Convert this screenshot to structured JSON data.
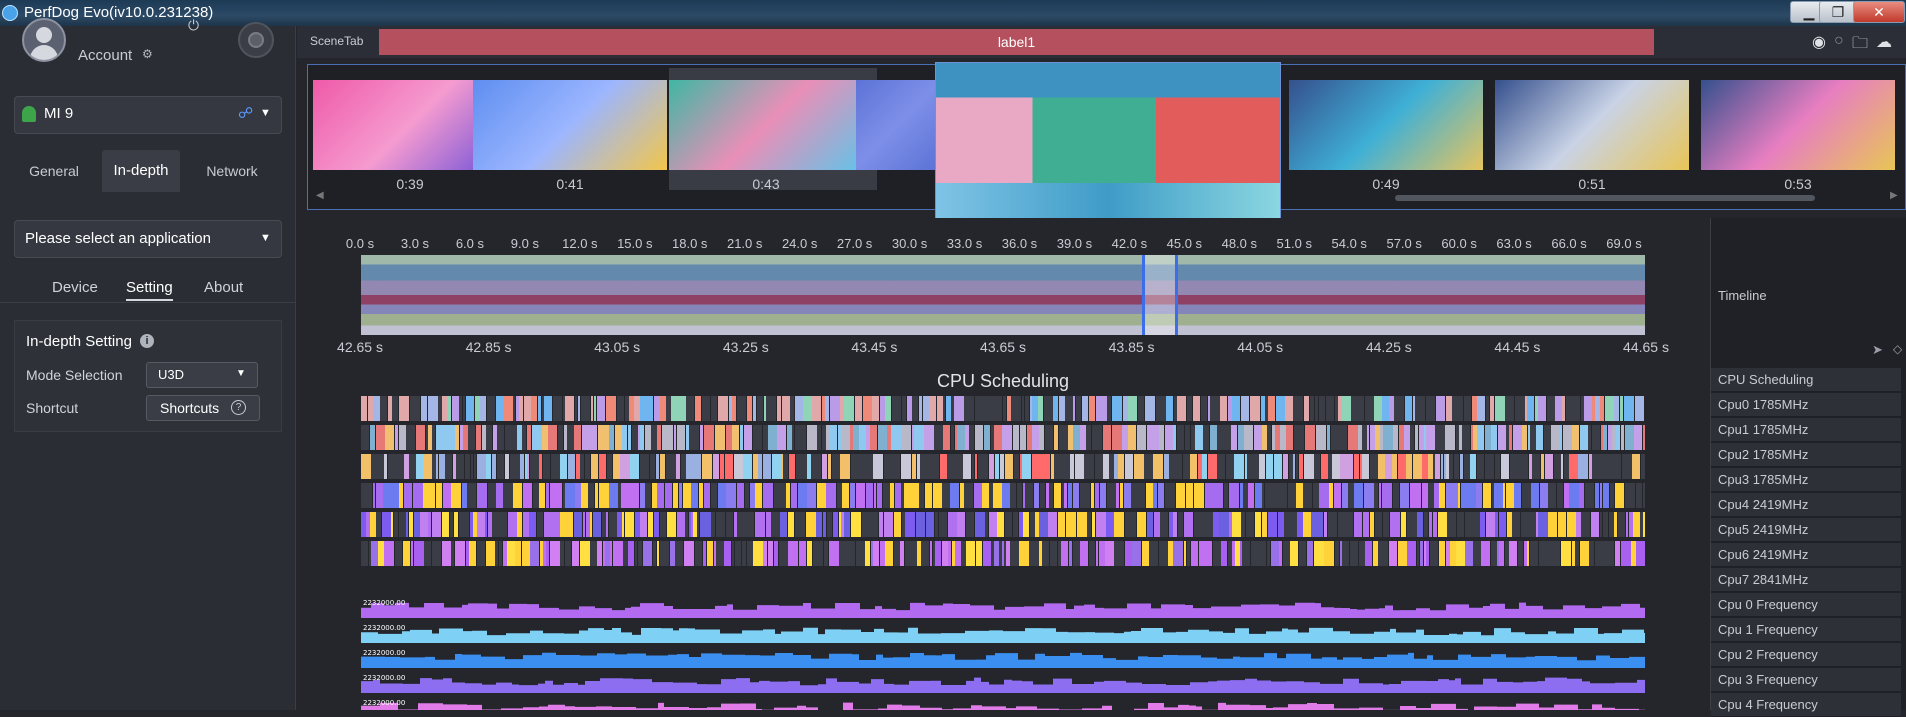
{
  "window": {
    "title": "PerfDog Evo(iv10.0.231238)",
    "minimize": "▁",
    "maximize": "❐",
    "close": "✕"
  },
  "left": {
    "account_label": "Account",
    "device": "MI 9",
    "tabs": [
      "General",
      "In-depth",
      "Network"
    ],
    "app_select_placeholder": "Please select an application",
    "subtabs": [
      "Device",
      "Setting",
      "About"
    ],
    "settings": {
      "title": "In-depth Setting",
      "mode_label": "Mode Selection",
      "mode_value": "U3D",
      "shortcut_label": "Shortcut",
      "shortcut_button": "Shortcuts"
    }
  },
  "scene": {
    "tab_label": "SceneTab",
    "label": "label1"
  },
  "thumbnails": [
    {
      "time": "0:39",
      "colors": [
        "#ef5aa8",
        "#f59bd0",
        "#6b4fd8"
      ]
    },
    {
      "time": "0:41",
      "colors": [
        "#5e8ef0",
        "#9cb6ff",
        "#f2c64b"
      ]
    },
    {
      "time": "0:43",
      "colors": [
        "#3fb7a3",
        "#e98fb7",
        "#62c3e8"
      ]
    },
    {
      "time": "",
      "colors": [
        "#5c73d6",
        "#7d8fe8",
        "#5c73d6"
      ]
    },
    {
      "time": "0:49",
      "colors": [
        "#35508d",
        "#3fb0d6",
        "#e6c45e"
      ]
    },
    {
      "time": "0:51",
      "colors": [
        "#35508d",
        "#c9d3e6",
        "#e8c556"
      ]
    },
    {
      "time": "0:53",
      "colors": [
        "#35508d",
        "#e77ec1",
        "#e8c556"
      ]
    }
  ],
  "ruler_top": [
    "0.0 s",
    "3.0 s",
    "6.0 s",
    "9.0 s",
    "12.0 s",
    "15.0 s",
    "18.0 s",
    "21.0 s",
    "24.0 s",
    "27.0 s",
    "30.0 s",
    "33.0 s",
    "36.0 s",
    "39.0 s",
    "42.0 s",
    "45.0 s",
    "48.0 s",
    "51.0 s",
    "54.0 s",
    "57.0 s",
    "60.0 s",
    "63.0 s",
    "66.0 s",
    "69.0 s"
  ],
  "ruler_bottom": [
    "42.65 s",
    "42.85 s",
    "43.05 s",
    "43.25 s",
    "43.45 s",
    "43.65 s",
    "43.85 s",
    "44.05 s",
    "44.25 s",
    "44.45 s",
    "44.65 s"
  ],
  "chart": {
    "title": "CPU Scheduling",
    "lane_colors": [
      [
        "#e0a8a8",
        "#a3b6e6",
        "#8fd4b7",
        "#f08a78",
        "#b99be8",
        "#6fb6f0"
      ],
      [
        "#e67878",
        "#8fc9f0",
        "#c3a0e8",
        "#f0c070",
        "#7fb0d0",
        "#b8b8c8"
      ],
      [
        "#ff6b6b",
        "#90d2f0",
        "#d0a0e0",
        "#f3c06a",
        "#9ab0e0",
        "#c8c8d8"
      ],
      [
        "#ffd23a",
        "#a66cf0",
        "#8b7cf0",
        "#c070f0",
        "#ffd23a",
        "#6c7cf0"
      ],
      [
        "#ffd23a",
        "#b070f0",
        "#6a60e0",
        "#c080f0",
        "#ffe040",
        "#7c5cf0"
      ],
      [
        "#ffd23a",
        "#a860f0",
        "#d080f0",
        "#ffe040",
        "#9870e8",
        "#c070f0"
      ]
    ],
    "freq_colors": [
      "#b26bf0",
      "#7ed0f5",
      "#3a8ff0",
      "#8d6df0",
      "#e07be8"
    ],
    "freq_axis_label": "2232000.00"
  },
  "right_panel": {
    "timeline_label": "Timeline",
    "rows": [
      "CPU Scheduling",
      "Cpu0  1785MHz",
      "Cpu1  1785MHz",
      "Cpu2  1785MHz",
      "Cpu3  1785MHz",
      "Cpu4  2419MHz",
      "Cpu5  2419MHz",
      "Cpu6  2419MHz",
      "Cpu7  2841MHz",
      "Cpu 0 Frequency",
      "Cpu 1 Frequency",
      "Cpu 2 Frequency",
      "Cpu 3 Frequency",
      "Cpu 4 Frequency"
    ]
  }
}
